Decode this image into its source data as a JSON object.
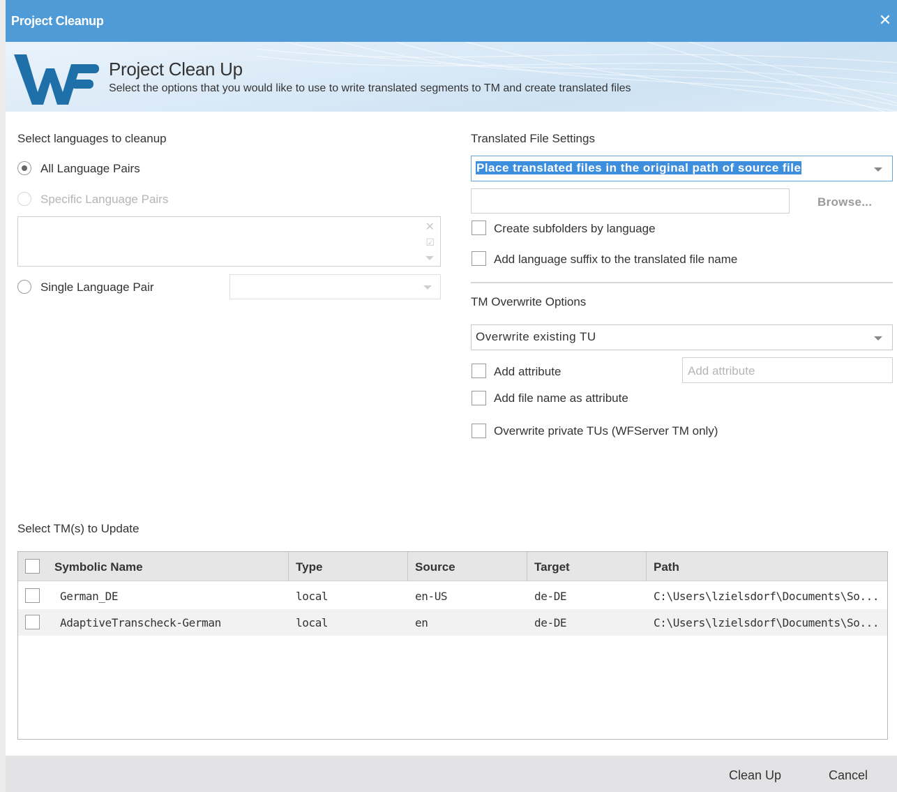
{
  "window": {
    "title": "Project Cleanup",
    "close": "✕"
  },
  "banner": {
    "heading": "Project Clean Up",
    "subtitle": "Select the options that you would like to use to write translated segments to TM and create translated files"
  },
  "languages": {
    "section_label": "Select languages to cleanup",
    "all_pairs": "All Language Pairs",
    "specific_pairs": "Specific Language Pairs",
    "single_pair": "Single Language Pair",
    "selected": "all"
  },
  "translated_files": {
    "section_label": "Translated File Settings",
    "placement_value": "Place translated files in the original path of source file",
    "browse_label": "Browse...",
    "create_subfolders": "Create subfolders by language",
    "add_suffix": "Add language suffix to the translated file name"
  },
  "tm_overwrite": {
    "section_label": "TM Overwrite Options",
    "mode_value": "Overwrite existing TU",
    "add_attribute": "Add attribute",
    "attribute_placeholder": "Add attribute",
    "add_filename_attribute": "Add file name as attribute",
    "overwrite_private": "Overwrite private TUs (WFServer TM only)"
  },
  "tm_table": {
    "section_label": "Select TM(s) to Update",
    "columns": [
      "Symbolic Name",
      "Type",
      "Source",
      "Target",
      "Path"
    ],
    "rows": [
      [
        "German_DE",
        "local",
        "en-US",
        "de-DE",
        "C:\\Users\\lzielsdorf\\Documents\\So..."
      ],
      [
        "AdaptiveTranscheck-German",
        "local",
        "en",
        "de-DE",
        "C:\\Users\\lzielsdorf\\Documents\\So..."
      ]
    ]
  },
  "footer": {
    "cleanup_label": "Clean Up",
    "cancel_label": "Cancel"
  },
  "colors": {
    "titlebar": "#4e9bd8",
    "accent": "#3d8fde",
    "logo": "#1f6fa8"
  },
  "icons": {
    "close": "close-icon",
    "clear": "clear-icon",
    "select_all": "select-all-icon",
    "dropdown": "chevron-down-icon"
  }
}
